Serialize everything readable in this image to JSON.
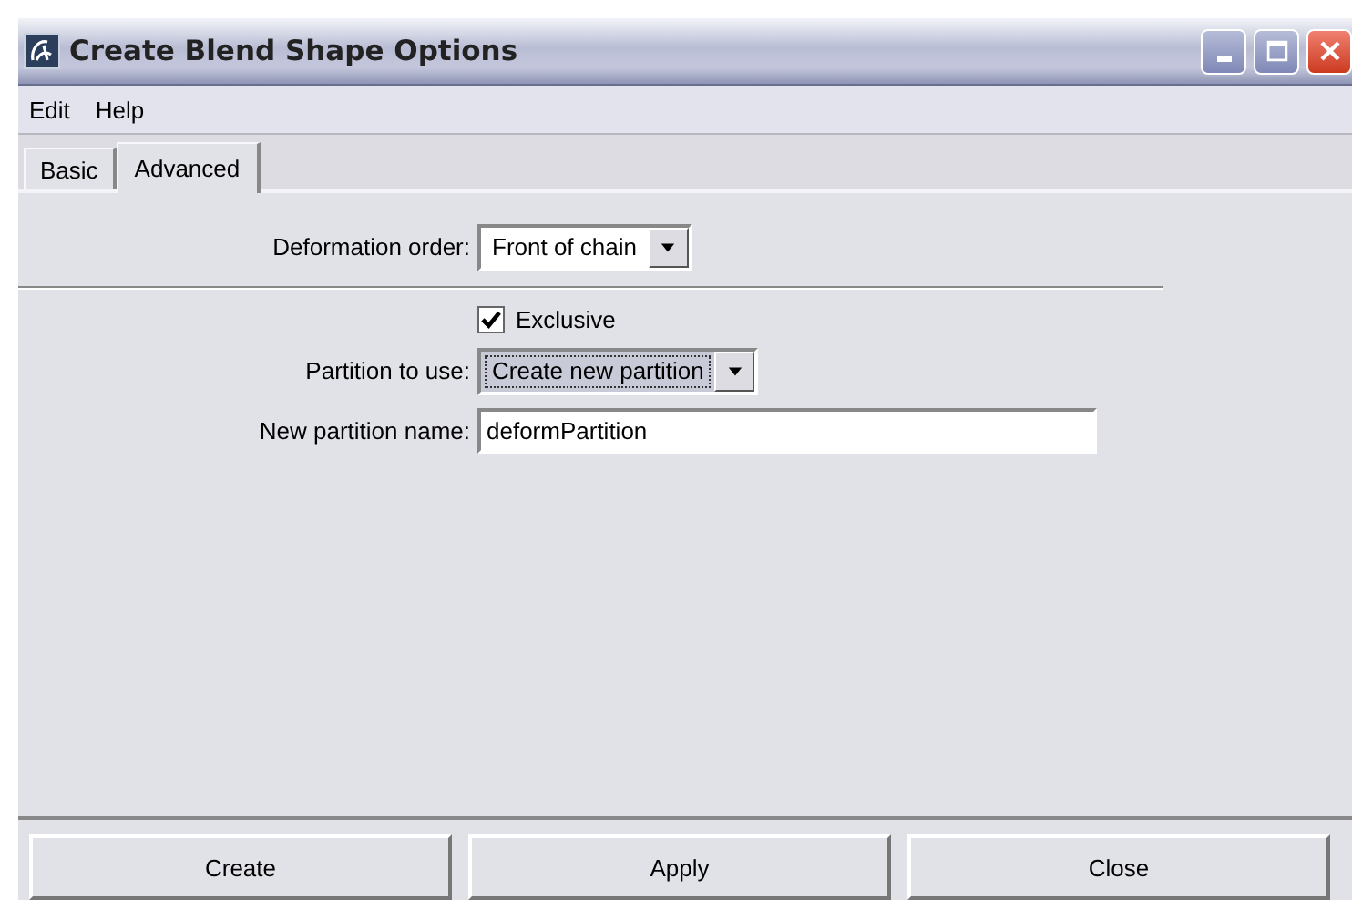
{
  "window": {
    "title": "Create Blend Shape Options"
  },
  "menu": [
    "Edit",
    "Help"
  ],
  "tabs": [
    {
      "label": "Basic",
      "selected": false
    },
    {
      "label": "Advanced",
      "selected": true
    }
  ],
  "deformation_order": {
    "label": "Deformation order:",
    "value": "Front of chain"
  },
  "exclusive": {
    "label": "Exclusive",
    "checked": true
  },
  "partition_to_use": {
    "label": "Partition to use:",
    "value": "Create new partition",
    "focused": true
  },
  "new_partition_name": {
    "label": "New partition name:",
    "value": "deformPartition"
  },
  "buttons": [
    "Create",
    "Apply",
    "Close"
  ]
}
